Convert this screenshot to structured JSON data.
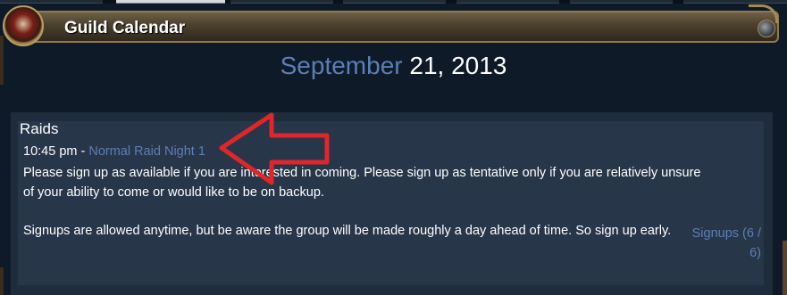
{
  "window": {
    "title": "Guild Calendar"
  },
  "date": {
    "month": "September",
    "rest": "21, 2013"
  },
  "section": {
    "title": "Raids"
  },
  "event": {
    "time": "10:45 pm",
    "separator": " - ",
    "name": "Normal Raid Night 1",
    "description_1": "Please sign up as available if you are interested in coming. Please sign up as tentative only if you are relatively unsure of your ability to come or would like to be on backup.",
    "description_2": "Signups are allowed anytime, but be aware the group will be made roughly a day ahead of time. So sign up early.",
    "signups": "Signups (6 / 6)"
  },
  "colors": {
    "accent": "#5b7fb4",
    "annotation_arrow": "#e0262a",
    "background": "#0e1a27"
  },
  "icons": {
    "emblem": "guild-emblem-icon",
    "annotation": "red-arrow-icon"
  }
}
